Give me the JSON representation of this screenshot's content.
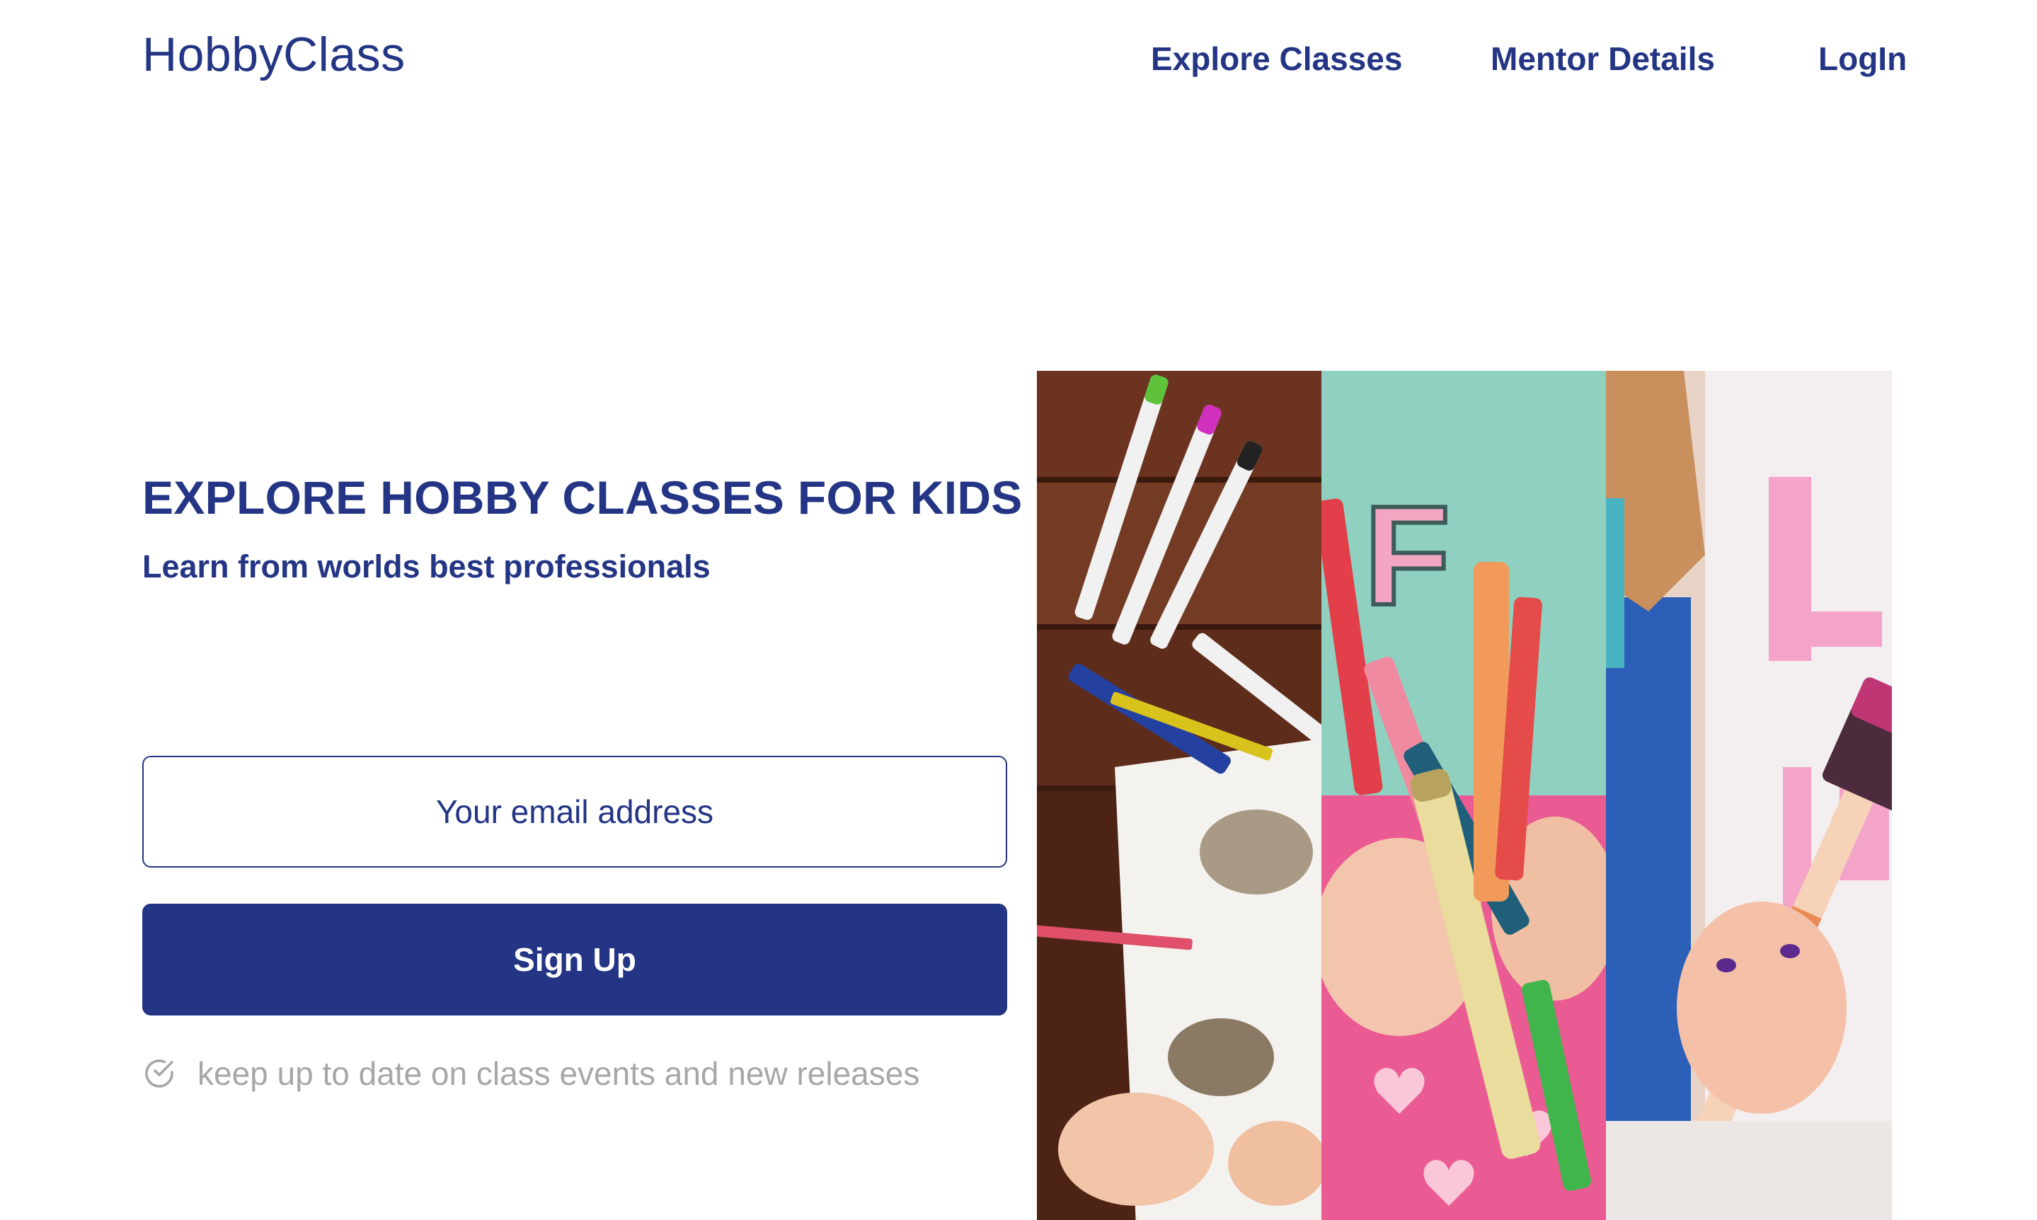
{
  "header": {
    "brand": "HobbyClass",
    "nav": [
      {
        "label": "Explore Classes"
      },
      {
        "label": "Mentor Details"
      },
      {
        "label": "LogIn"
      }
    ]
  },
  "hero": {
    "title": "EXPLORE HOBBY CLASSES FOR KIDS",
    "subtitle": "Learn from worlds best professionals"
  },
  "form": {
    "email_placeholder": "Your email address",
    "signup_label": "Sign Up",
    "note": "keep up to date on class events and new releases"
  },
  "colors": {
    "primary": "#233584",
    "note_text": "#a7a7a7",
    "background": "#ffffff"
  },
  "images": [
    {
      "name": "markers-on-wooden-table-photo"
    },
    {
      "name": "hands-holding-crayons-photo"
    },
    {
      "name": "child-holding-sponge-brush-photo"
    }
  ]
}
